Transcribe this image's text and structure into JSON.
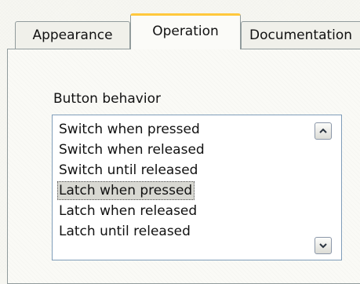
{
  "tabs": [
    {
      "label": "Appearance",
      "active": false
    },
    {
      "label": "Operation",
      "active": true
    },
    {
      "label": "Documentation",
      "active": false
    }
  ],
  "operation": {
    "group_label": "Button behavior",
    "listbox": {
      "items": [
        "Switch when pressed",
        "Switch when released",
        "Switch until released",
        "Latch when pressed",
        "Latch when released",
        "Latch until released"
      ],
      "selected_item": "Latch when pressed"
    },
    "scrollbar": {
      "up_icon": "chevron-up-icon",
      "down_icon": "chevron-down-icon"
    }
  },
  "colors": {
    "active_tab_accent": "#ffc83c",
    "border": "#919b9c",
    "listbox_border": "#7f9db9",
    "selection": "#d8d8d2"
  }
}
